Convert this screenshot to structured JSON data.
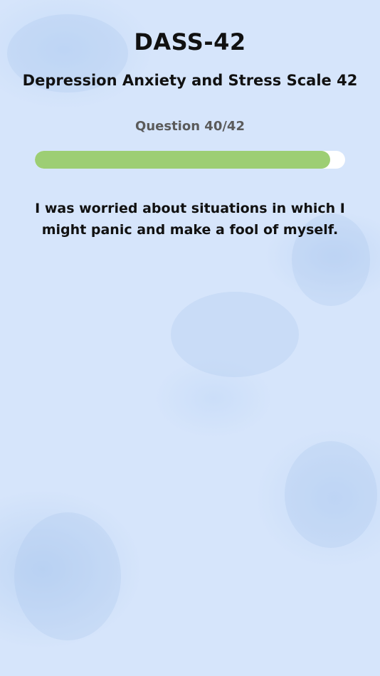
{
  "header": {
    "title": "DASS-42",
    "subtitle": "Depression Anxiety and Stress Scale 42"
  },
  "progress": {
    "label": "Question 40/42",
    "current": 40,
    "total": 42,
    "fill_fraction": 0.952,
    "fill_color": "#9dce74",
    "track_color": "#ffffff"
  },
  "question": {
    "text": "I was worried about situations in which I might panic and make a fool of myself."
  },
  "theme": {
    "background": "#d6e5fb",
    "text_color": "#111111",
    "counter_color": "#5b5b5b"
  }
}
